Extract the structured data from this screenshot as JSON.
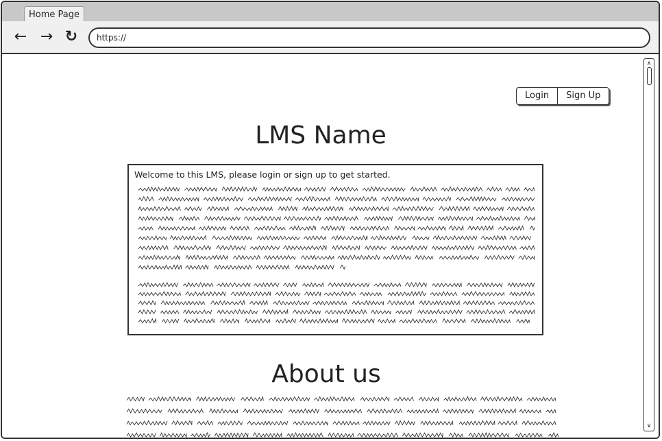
{
  "browser": {
    "tab_title": "Home Page",
    "url": "https://",
    "back_icon": "arrow-left-icon",
    "forward_icon": "arrow-right-icon",
    "reload_icon": "reload-icon"
  },
  "header": {
    "login_label": "Login",
    "signup_label": "Sign Up"
  },
  "main": {
    "title": "LMS Name",
    "welcome_text": "Welcome to this LMS, please login or sign up to get started."
  },
  "about": {
    "title": "About us"
  },
  "scrollbar": {
    "up_icon": "scroll-up-icon",
    "down_icon": "scroll-down-icon"
  }
}
